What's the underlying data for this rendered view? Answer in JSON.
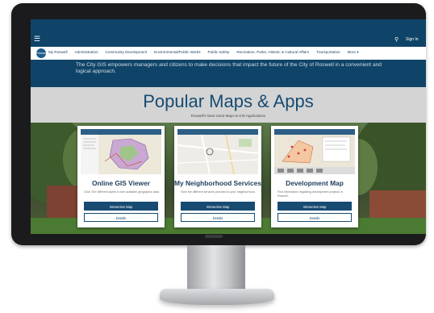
{
  "header": {
    "menu_icon": "hamburger-icon",
    "search_icon": "search-icon",
    "signin_label": "Sign In"
  },
  "nav": {
    "logo_text": "Roswell",
    "items": [
      "My Roswell",
      "Administration",
      "Community Development",
      "Environmental/Public Works",
      "Public Safety",
      "Recreation, Parks, Historic & Cultural Affairs",
      "Transportation",
      "More ▾"
    ]
  },
  "intro": {
    "text": "The City GIS empowers managers and citizens to make decisions that impact the future of the City of Roswell in a convenient and logical approach."
  },
  "hero": {
    "title": "Popular Maps & Apps",
    "subtitle": "Roswell's Most Used Maps & GIS Applications"
  },
  "cards": [
    {
      "title": "Online GIS Viewer",
      "description": "Click 'ON' different layers to see available geographic data.",
      "primary_label": "Interactive Map",
      "secondary_label": "Details"
    },
    {
      "title": "My Neighborhood Services",
      "description": "View the different services provided to your neighborhood.",
      "primary_label": "Interactive Map",
      "secondary_label": "Details"
    },
    {
      "title": "Development Map",
      "description": "Find information regarding development projects in Roswell.",
      "primary_label": "Interactive Map",
      "secondary_label": "Details"
    }
  ],
  "colors": {
    "brand_dark": "#0f4468",
    "brand_title": "#174b72",
    "hero_band": "#d4d4d4"
  }
}
